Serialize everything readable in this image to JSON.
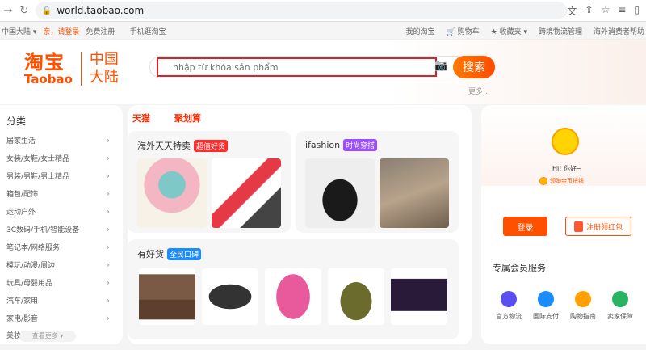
{
  "browser": {
    "url": "world.taobao.com"
  },
  "site_top": {
    "region": "中国大陆",
    "login_link": "亲，请登录",
    "register_link": "免费注册",
    "mobile_link": "手机逛淘宝",
    "right_links": [
      "我的淘宝",
      "购物车",
      "收藏夹",
      "跨境物流管理",
      "海外消费者帮助"
    ]
  },
  "header": {
    "logo_cn": "淘宝",
    "logo_en": "Taobao",
    "region_line1": "中国",
    "region_line2": "大陆",
    "search_placeholder": "nhập từ khóa sản phẩm",
    "search_button": "搜索",
    "more_link": "更多..."
  },
  "categories": {
    "title": "分类",
    "items": [
      "居家生活",
      "女装/女鞋/女士精品",
      "男装/男鞋/男士精品",
      "箱包/配饰",
      "运动户外",
      "3C数码/手机/智能设备",
      "笔记本/网络服务",
      "模玩/动漫/周边",
      "玩具/母婴用品",
      "汽车/家用",
      "家电/影音",
      "美妆/洗护"
    ],
    "more_label": "查看更多"
  },
  "center": {
    "tabs": [
      "天猫",
      "聚划算"
    ],
    "box1": {
      "title": "海外天天特卖",
      "badge": "超值好货"
    },
    "box2": {
      "title": "ifashion",
      "badge": "时尚穿搭"
    },
    "box3": {
      "title": "有好货",
      "badge": "全民口碑"
    }
  },
  "user_panel": {
    "greeting": "Hi! 你好~",
    "coin_text": "领淘金币抵钱",
    "login_button": "登录",
    "register_button": "注册领红包",
    "services_title": "专属会员服务",
    "services": [
      "官方物流",
      "国际支付",
      "购物指南",
      "卖家保障"
    ]
  },
  "colors": {
    "brand": "#ff5000",
    "tab_red": "#ff2b00",
    "badge_red": "#ff2b2b",
    "badge_purple": "#9b4dff",
    "badge_blue": "#1a8cff"
  }
}
